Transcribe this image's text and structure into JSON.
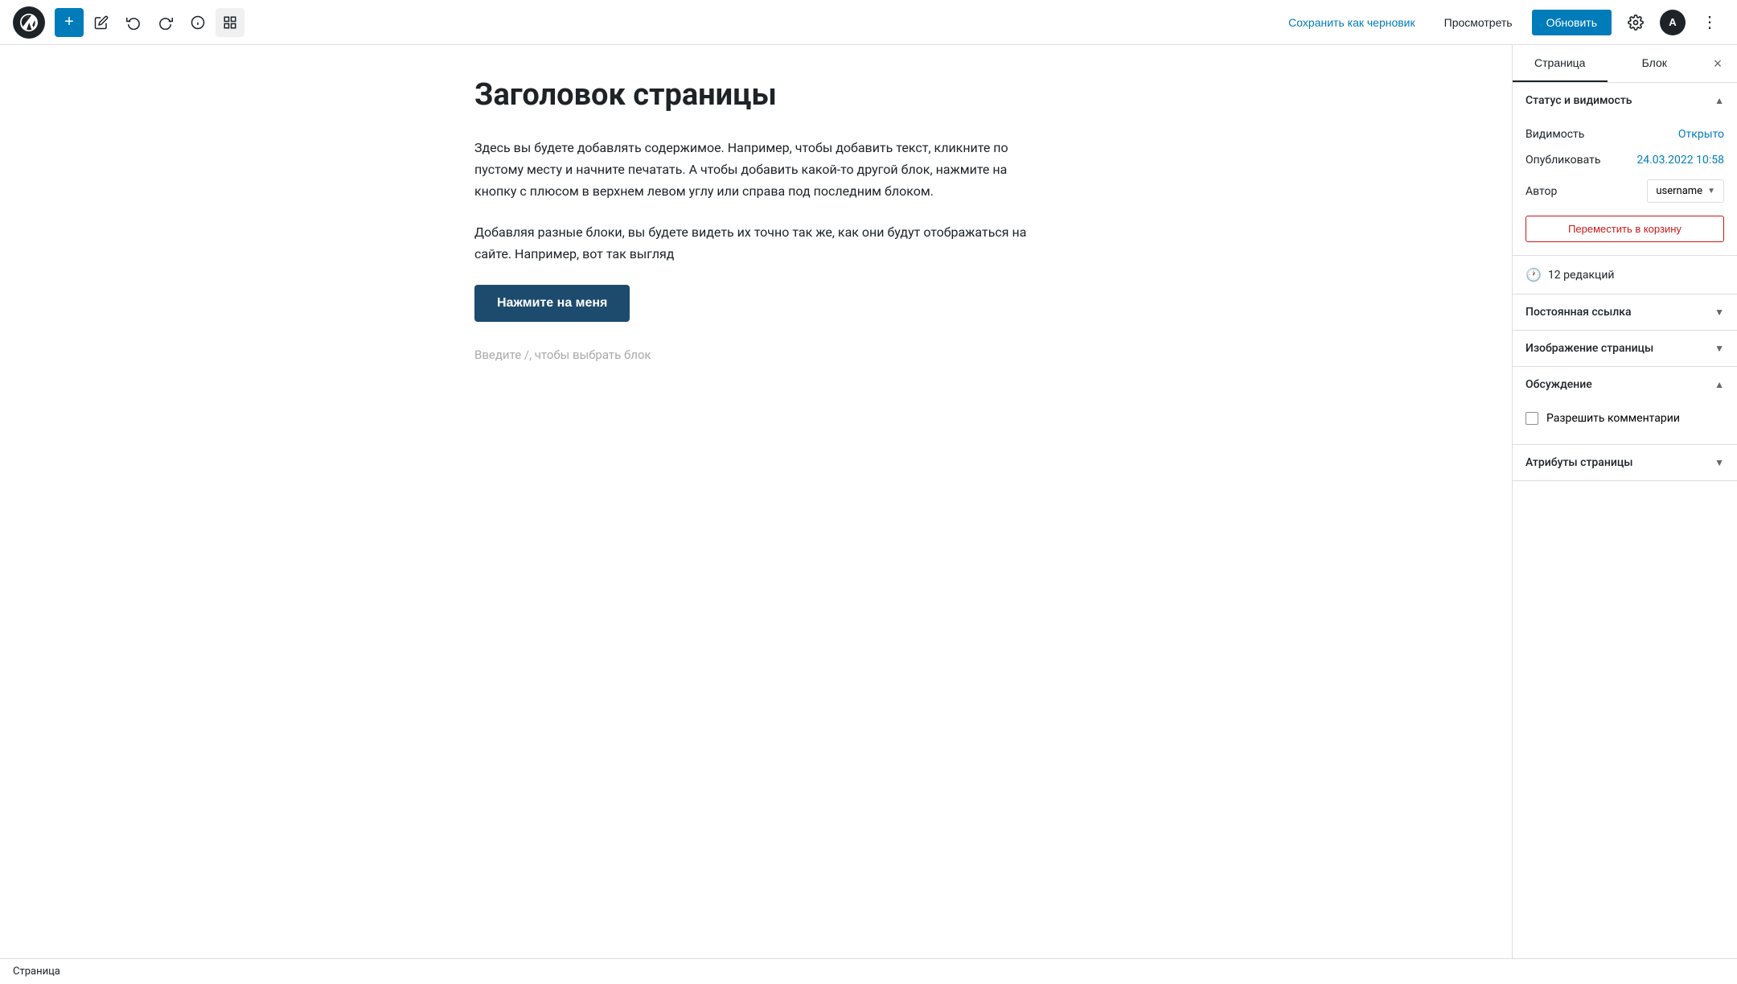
{
  "toolbar": {
    "add_label": "+",
    "save_draft_label": "Сохранить как черновик",
    "preview_label": "Просмотреть",
    "update_label": "Обновить",
    "more_label": "⋮"
  },
  "editor": {
    "page_title": "Заголовок страницы",
    "paragraph1": "Здесь вы будете добавлять содержимое. Например, чтобы добавить текст, кликните по пустому месту и начните печатать. А чтобы добавить какой-то другой блок, нажмите на кнопку с плюсом в верхнем левом углу или справа под последним блоком.",
    "paragraph2": "Добавляя разные блоки, вы будете видеть их точно так же, как они будут отображаться на сайте. Например, вот так выгляд",
    "button_text": "Нажмите на меня",
    "placeholder": "Введите /, чтобы выбрать блок"
  },
  "sidebar": {
    "tab_page": "Страница",
    "tab_block": "Блок",
    "close_label": "×",
    "status_section": {
      "title": "Статус и видимость",
      "visibility_label": "Видимость",
      "visibility_value": "Открыто",
      "publish_label": "Опубликовать",
      "publish_value": "24.03.2022 10:58",
      "author_label": "Автор",
      "author_value": "username",
      "trash_label": "Переместить в корзину"
    },
    "revisions": {
      "label": "12 редакций"
    },
    "permalink_section": {
      "title": "Постоянная ссылка"
    },
    "featured_image_section": {
      "title": "Изображение страницы"
    },
    "discussion_section": {
      "title": "Обсуждение",
      "comments_label": "Разрешить комментарии"
    },
    "attributes_section": {
      "title": "Атрибуты страницы"
    }
  },
  "footer": {
    "label": "Страница"
  }
}
